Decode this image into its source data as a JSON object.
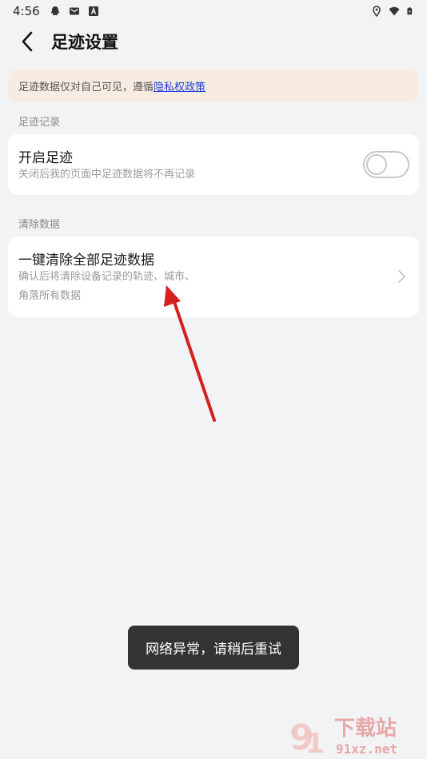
{
  "status_bar": {
    "time": "4:56",
    "left_icons": [
      "qq-icon",
      "mail-icon",
      "a-icon"
    ],
    "right_icons": [
      "location-icon",
      "wifi-icon",
      "battery-icon"
    ]
  },
  "header": {
    "title": "足迹设置"
  },
  "notice": {
    "text": "足迹数据仅对自己可见，遵循",
    "link": "隐私权政策"
  },
  "sections": {
    "record_label": "足迹记录",
    "clear_label": "清除数据"
  },
  "enable_footprint": {
    "title": "开启足迹",
    "subtitle": "关闭后我的页面中足迹数据将不再记录",
    "enabled": false
  },
  "clear_all": {
    "title": "一键清除全部足迹数据",
    "subtitle_line1": "确认后将清除设备记录的轨迹、城市、",
    "subtitle_line2": "角落所有数据"
  },
  "toast": {
    "text": "网络异常，请稍后重试"
  },
  "watermark": {
    "text1": "下载站",
    "text2": "91xz.net"
  },
  "colors": {
    "background": "#f2f3f5",
    "notice_bg": "#f8ece2",
    "link": "#1a3fd6",
    "annotation_arrow": "#d62020",
    "toast_bg": "#333333"
  }
}
